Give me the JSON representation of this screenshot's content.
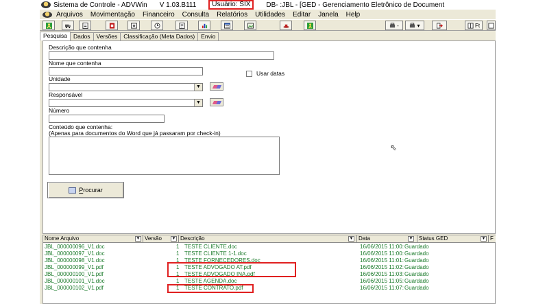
{
  "window": {
    "app_title": "Sistema de Controle - ADVWin",
    "version": "V 1.03.B111",
    "user": "Usuário: SIX",
    "db": "DB- :JBL - [GED - Gerenciamento Eletrônico de Document"
  },
  "menu": [
    "Arquivos",
    "Movimentação",
    "Financeiro",
    "Consulta",
    "Relatórios",
    "Utilidades",
    "Editar",
    "Janela",
    "Help"
  ],
  "toolbar": {
    "ft_label": "Ft"
  },
  "tabs": [
    "Pesquisa",
    "Dados",
    "Versões",
    "Classificação (Meta Dados)",
    "Envio"
  ],
  "form": {
    "descricao_label": "Descrição que contenha",
    "nome_label": "Nome que contenha",
    "usar_datas_label": "Usar datas",
    "unidade_label": "Unidade",
    "responsavel_label": "Responsável",
    "numero_label": "Número",
    "conteudo_label": "Conteúdo que contenha:",
    "conteudo_note": "(Apenas para documentos do Word que já passaram por check-in)",
    "procurar_prefix": "P",
    "procurar_rest": "rocurar"
  },
  "grid": {
    "columns": [
      "Nome Arquivo",
      "Versão",
      "Descrição",
      "Data",
      "Status GED",
      "F"
    ],
    "rows": [
      {
        "file": "JBL_000000096_V1.doc",
        "version": "1",
        "desc": "TESTE CLIENTE.doc",
        "date": "16/06/2015 11:00:",
        "status": "Guardado"
      },
      {
        "file": "JBL_000000097_V1.doc",
        "version": "1",
        "desc": "TESTE CLIENTE 1-1.doc",
        "date": "16/06/2015 11:00:",
        "status": "Guardado"
      },
      {
        "file": "JBL_000000098_V1.doc",
        "version": "1",
        "desc": "TESTE FORNECEDORES.doc",
        "date": "16/06/2015 11:01:",
        "status": "Guardado"
      },
      {
        "file": "JBL_000000099_V1.pdf",
        "version": "1",
        "desc": "TESTE ADVOGADO AT.pdf",
        "date": "16/06/2015 11:02:",
        "status": "Guardado"
      },
      {
        "file": "JBL_000000100_V1.pdf",
        "version": "1",
        "desc": "TESTE ADVOGADO INA.pdf",
        "date": "16/06/2015 11:03:",
        "status": "Guardado"
      },
      {
        "file": "JBL_000000101_V1.doc",
        "version": "1",
        "desc": "TESTE AGENDA.doc",
        "date": "16/06/2015 11:05:",
        "status": "Guardado"
      },
      {
        "file": "JBL_000000102_V1.pdf",
        "version": "1",
        "desc": "TESTE CONTRATO.pdf",
        "date": "16/06/2015 11:07:",
        "status": "Guardado"
      }
    ]
  },
  "colors": {
    "highlight": "#e02020",
    "row_text": "#1a7a2a",
    "chrome": "#ece9d8"
  },
  "icons": [
    "app-logo-icon",
    "person-icon",
    "truck-icon",
    "document-icon",
    "pdf-icon",
    "photo-icon",
    "clock-icon",
    "page-icon",
    "bar-chart-icon",
    "calendar-icon",
    "image-icon",
    "hat-icon",
    "figure-icon",
    "printer-icon",
    "exit-icon",
    "book-icon",
    "eraser-icon",
    "search-icon",
    "mouse-cursor-icon"
  ]
}
